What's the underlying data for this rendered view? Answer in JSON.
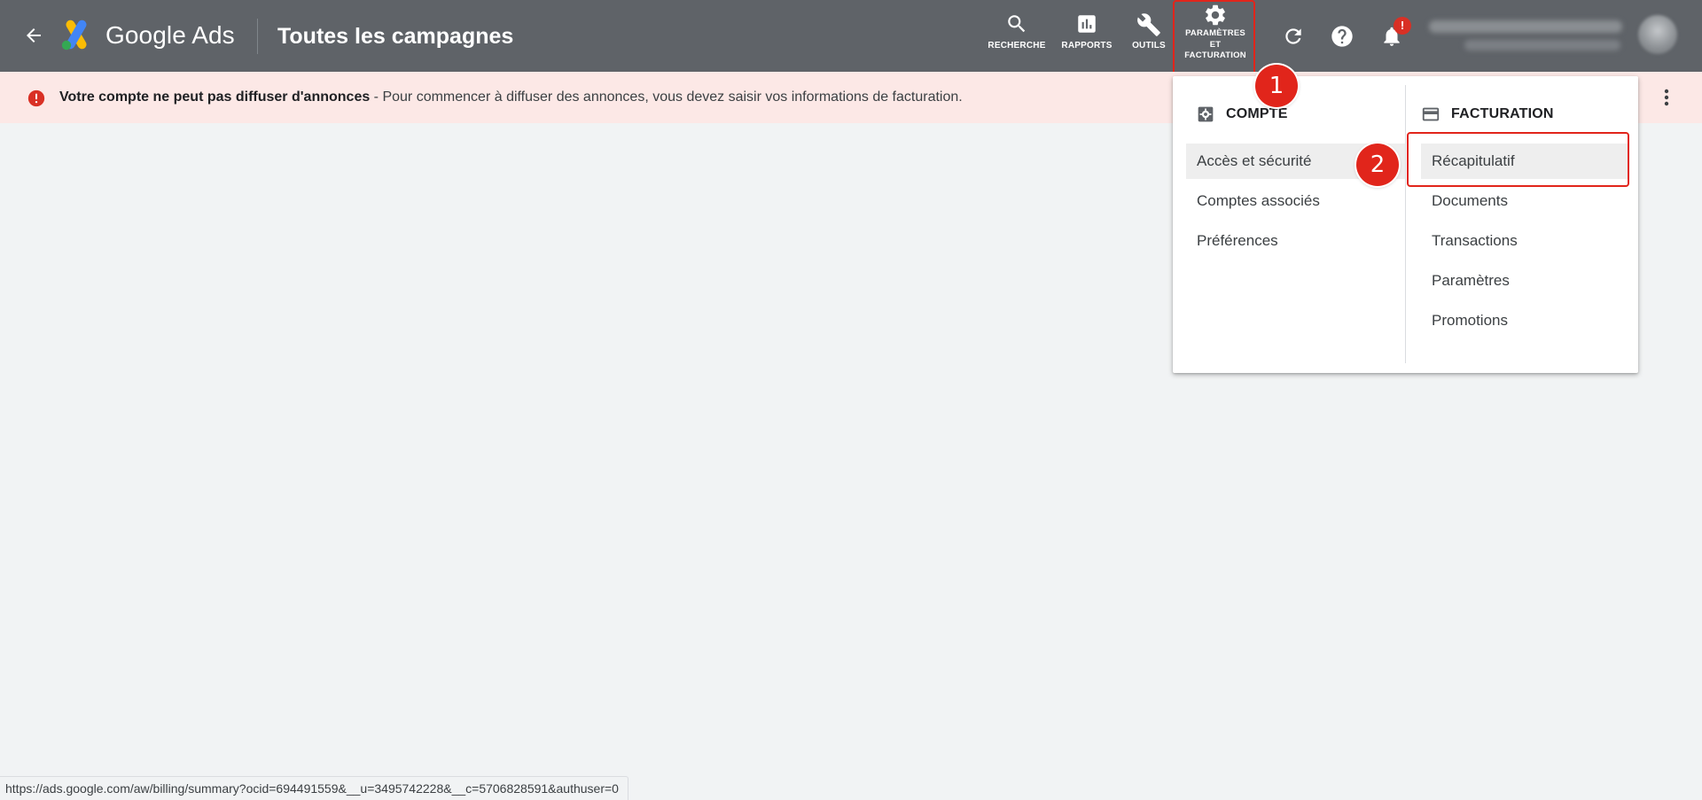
{
  "header": {
    "brand": "Google Ads",
    "page_title": "Toutes les campagnes",
    "tools": {
      "search": "RECHERCHE",
      "reports": "RAPPORTS",
      "tools": "OUTILS",
      "settings_line1": "PARAMÈTRES",
      "settings_line2": "ET",
      "settings_line3": "FACTURATION"
    },
    "notification_badge": "!"
  },
  "alert": {
    "bold": "Votre compte ne peut pas diffuser d'annonces",
    "rest": " - Pour commencer à diffuser des annonces, vous devez saisir vos informations de facturation."
  },
  "menu": {
    "account": {
      "heading": "COMPTE",
      "items": [
        "Accès et sécurité",
        "Comptes associés",
        "Préférences"
      ]
    },
    "billing": {
      "heading": "FACTURATION",
      "items": [
        "Récapitulatif",
        "Documents",
        "Transactions",
        "Paramètres",
        "Promotions"
      ]
    }
  },
  "steps": [
    "1",
    "2"
  ],
  "status_url": "https://ads.google.com/aw/billing/summary?ocid=694491559&__u=3495742228&__c=5706828591&authuser=0",
  "colors": {
    "topbar": "#5f6368",
    "alert_bg": "#fce8e6",
    "highlight": "#e1251b",
    "page_bg": "#f1f3f4"
  }
}
